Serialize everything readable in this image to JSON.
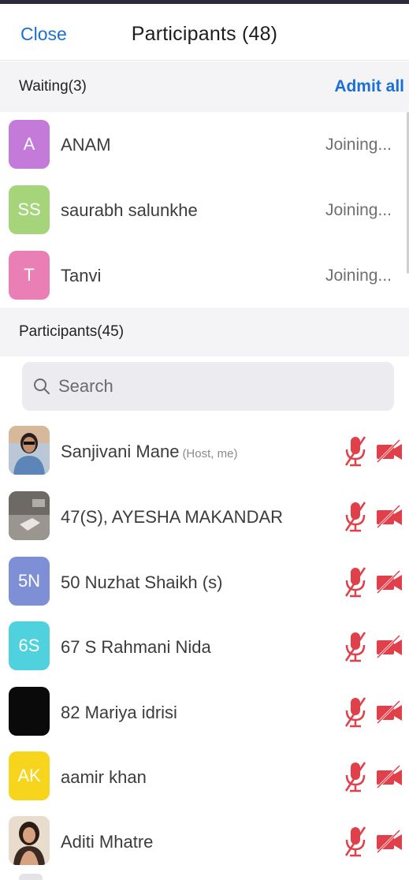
{
  "header": {
    "close_label": "Close",
    "title": "Participants (48)"
  },
  "waiting": {
    "title": "Waiting(3)",
    "admit_all_label": "Admit all",
    "items": [
      {
        "initials": "A",
        "name": "ANAM",
        "status": "Joining...",
        "color": "#c47ad9"
      },
      {
        "initials": "SS",
        "name": "saurabh salunkhe",
        "status": "Joining...",
        "color": "#a6d47a"
      },
      {
        "initials": "T",
        "name": "Tanvi",
        "status": "Joining...",
        "color": "#e97fb4"
      }
    ]
  },
  "participants": {
    "title": "Participants(45)",
    "search_placeholder": "Search",
    "items": [
      {
        "initials": "",
        "avatar_type": "photo",
        "name": "Sanjivani Mane",
        "sub": "(Host, me)",
        "audio": "muted",
        "video": "off"
      },
      {
        "initials": "",
        "avatar_type": "photo",
        "name": "47(S), AYESHA MAKANDAR",
        "sub": "",
        "audio": "muted",
        "video": "off"
      },
      {
        "initials": "5N",
        "avatar_type": "initials",
        "color": "#7f8fd6",
        "name": "50 Nuzhat Shaikh (s)",
        "sub": "",
        "audio": "muted",
        "video": "off"
      },
      {
        "initials": "6S",
        "avatar_type": "initials",
        "color": "#4fd1de",
        "name": "67 S Rahmani Nida",
        "sub": "",
        "audio": "muted",
        "video": "off"
      },
      {
        "initials": "",
        "avatar_type": "initials",
        "color": "#0a0a0a",
        "name": "82 Mariya idrisi",
        "sub": "",
        "audio": "muted",
        "video": "off"
      },
      {
        "initials": "AK",
        "avatar_type": "initials",
        "color": "#f7d51c",
        "name": "aamir khan",
        "sub": "",
        "audio": "muted",
        "video": "off"
      },
      {
        "initials": "",
        "avatar_type": "photo",
        "name": "Aditi Mhatre",
        "sub": "",
        "audio": "muted",
        "video": "off"
      }
    ]
  },
  "colors": {
    "accent": "#1a6fd6",
    "muted_icon": "#e0404a"
  },
  "icons": {
    "mic": "mic-muted-icon",
    "video": "video-off-icon",
    "search": "search-icon"
  }
}
